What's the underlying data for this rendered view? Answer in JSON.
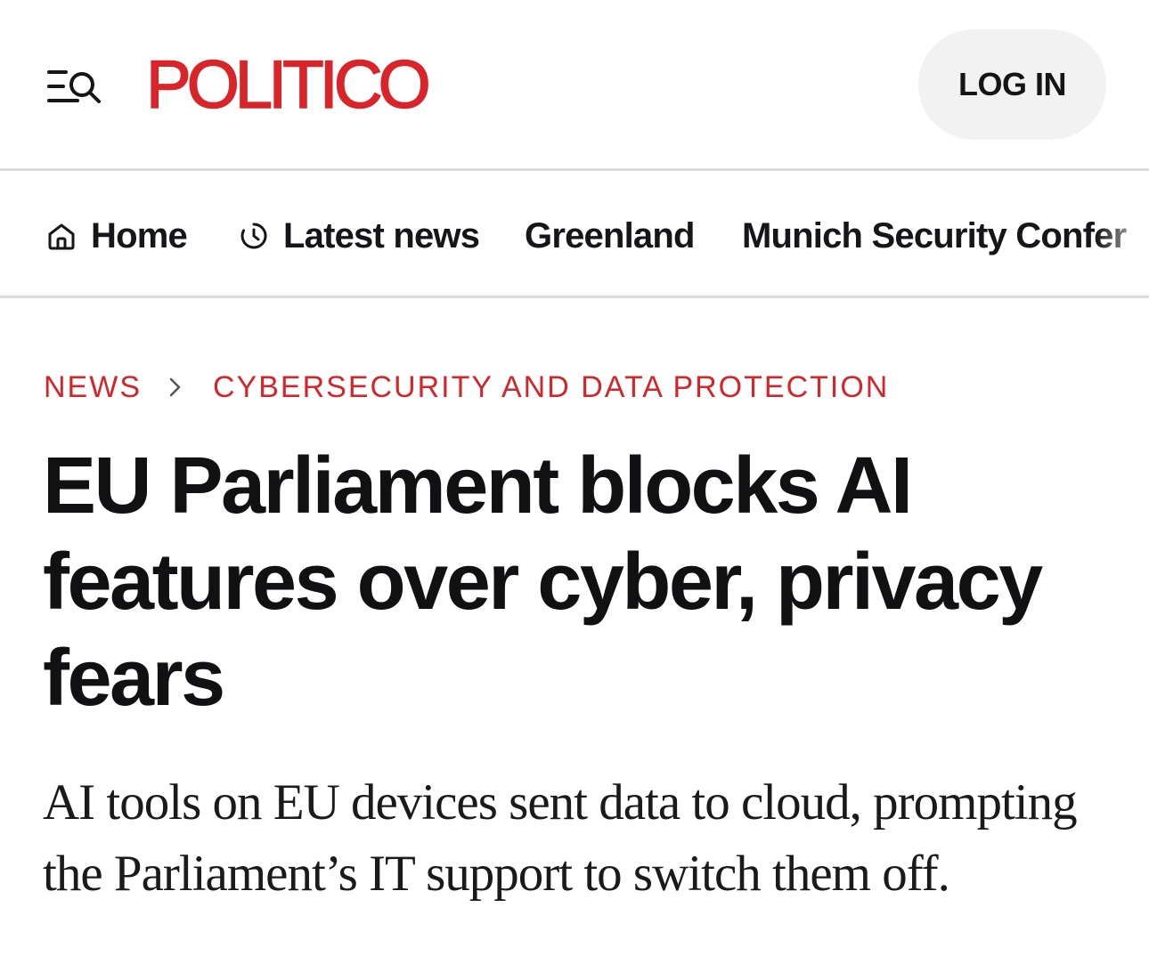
{
  "header": {
    "menu_icon": "menu-search-icon",
    "logo_text": "POLITICO",
    "login_label": "LOG IN",
    "brand_color": "#d9252a"
  },
  "nav": {
    "items": [
      {
        "label": "Home",
        "icon": "home-icon"
      },
      {
        "label": "Latest news",
        "icon": "clock-icon"
      },
      {
        "label": "Greenland"
      },
      {
        "label": "Munich Security Confer"
      }
    ]
  },
  "breadcrumb": {
    "items": [
      "NEWS",
      "CYBERSECURITY AND DATA PROTECTION"
    ],
    "separator_icon": "chevron-right-icon",
    "color": "#d2262b"
  },
  "article": {
    "headline": "EU Parliament blocks AI features over cyber, privacy fears",
    "dek": "AI tools on EU devices sent data to cloud, prompting the Parliament’s IT support to switch them off."
  }
}
